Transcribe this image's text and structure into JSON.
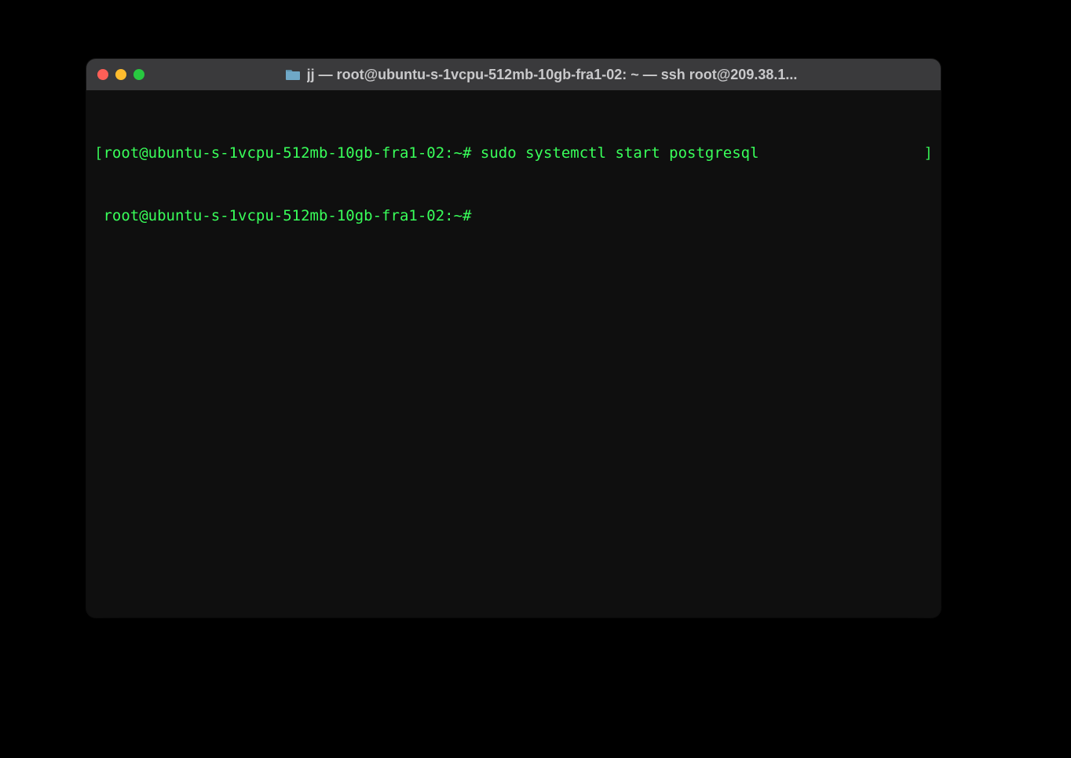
{
  "window": {
    "title": "jj — root@ubuntu-s-1vcpu-512mb-10gb-fra1-02: ~ — ssh root@209.38.1...",
    "traffic_lights": {
      "close": "close",
      "minimize": "minimize",
      "maximize": "maximize"
    }
  },
  "terminal": {
    "lines": [
      {
        "open_bracket": "[",
        "prompt": "root@ubuntu-s-1vcpu-512mb-10gb-fra1-02:~#",
        "command": "sudo systemctl start postgresql",
        "close_bracket": "]"
      },
      {
        "open_bracket": " ",
        "prompt": "root@ubuntu-s-1vcpu-512mb-10gb-fra1-02:~#",
        "command": "",
        "close_bracket": ""
      }
    ]
  },
  "colors": {
    "text": "#39ff5a",
    "background": "#0f0f0f",
    "titlebar": "#3a3a3c"
  }
}
